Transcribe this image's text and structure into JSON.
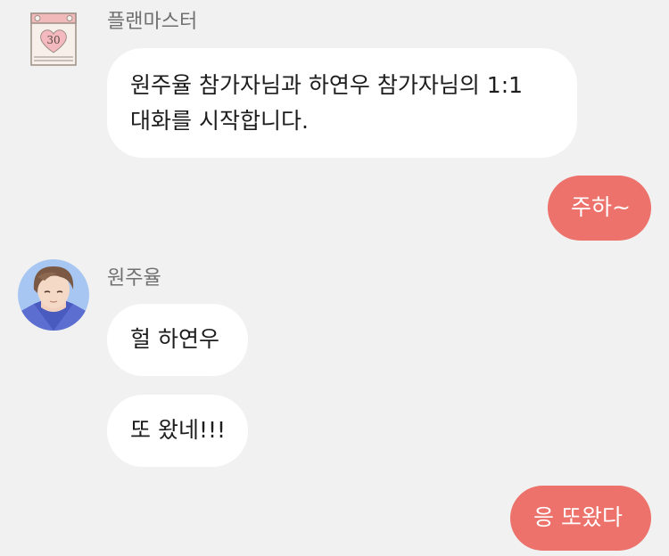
{
  "colors": {
    "background": "#f1f1f1",
    "incoming_bubble": "#ffffff",
    "outgoing_bubble": "#ec726b",
    "sender_name": "#707070",
    "message_text": "#1d1d1d"
  },
  "messages": [
    {
      "sender": "플랜마스터",
      "avatar": "calendar-heart-icon",
      "direction": "incoming",
      "lines": [
        "원주율 참가자님과 하연우 참가자님의 1:1",
        "대화를 시작합니다."
      ]
    },
    {
      "direction": "outgoing",
      "text": "주하~"
    },
    {
      "sender": "원주율",
      "avatar": "profile-photo",
      "direction": "incoming",
      "text": "헐 하연우"
    },
    {
      "direction": "incoming",
      "text": "또 왔네!!!"
    },
    {
      "direction": "outgoing",
      "text": "응 또왔다"
    }
  ],
  "calendar_avatar": {
    "number": "30"
  }
}
